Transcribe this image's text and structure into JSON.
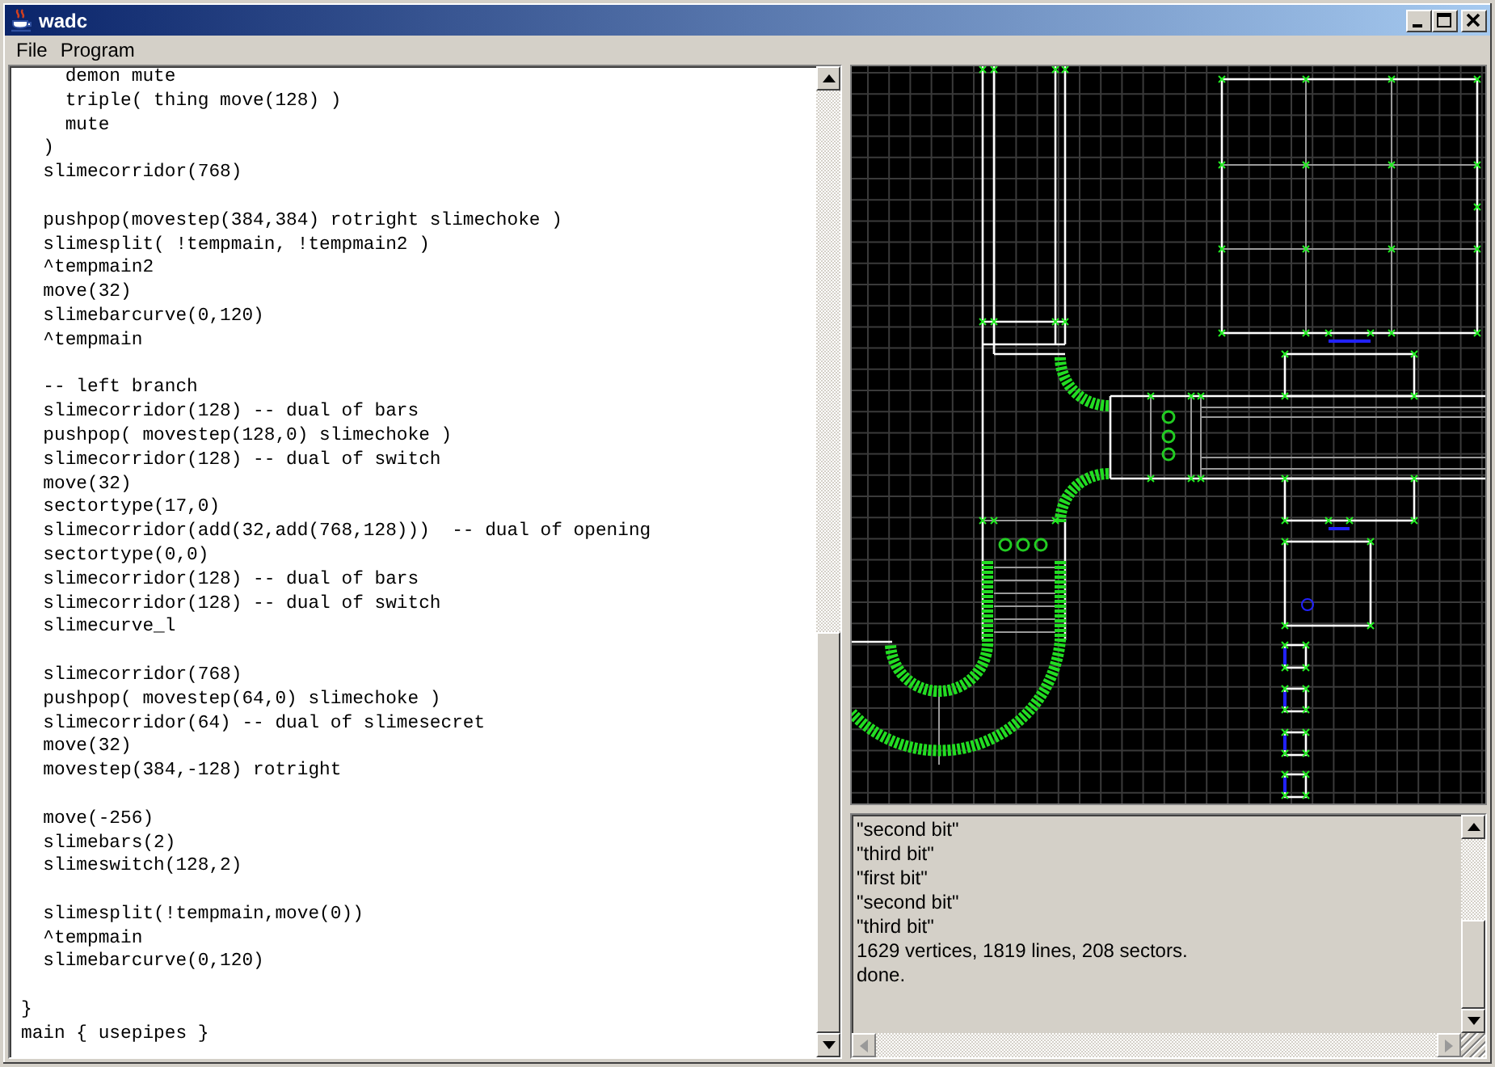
{
  "window": {
    "title": "wadc"
  },
  "menu": [
    "File",
    "Program"
  ],
  "editor": {
    "blocks": [
      [
        "    demon mute",
        "    triple( thing move(128) )",
        "    mute",
        "  )",
        "  slimecorridor(768)"
      ],
      [
        "  pushpop(movestep(384,384) rotright slimechoke )",
        "  slimesplit( !tempmain, !tempmain2 )",
        "  ^tempmain2",
        "  move(32)",
        "  slimebarcurve(0,120)",
        "  ^tempmain"
      ],
      [
        "  -- left branch",
        "  slimecorridor(128) -- dual of bars",
        "  pushpop( movestep(128,0) slimechoke )",
        "  slimecorridor(128) -- dual of switch",
        "  move(32)",
        "  sectortype(17,0)",
        "  slimecorridor(add(32,add(768,128)))  -- dual of opening",
        "  sectortype(0,0)",
        "  slimecorridor(128) -- dual of bars",
        "  slimecorridor(128) -- dual of switch",
        "  slimecurve_l"
      ],
      [
        "  slimecorridor(768)",
        "  pushpop( movestep(64,0) slimechoke )",
        "  slimecorridor(64) -- dual of slimesecret",
        "  move(32)",
        "  movestep(384,-128) rotright"
      ],
      [
        "  move(-256)",
        "  slimebars(2)",
        "  slimeswitch(128,2)"
      ],
      [
        "  slimesplit(!tempmain,move(0))",
        "  ^tempmain",
        "  slimebarcurve(0,120)"
      ],
      [
        "}",
        "main { usepipes }"
      ]
    ]
  },
  "log": {
    "lines": [
      "\"second bit\"",
      "\"third bit\"",
      "\"first bit\"",
      "\"second bit\"",
      "\"third bit\"",
      "1629 vertices, 1819 lines, 208 sectors.",
      "done."
    ]
  }
}
